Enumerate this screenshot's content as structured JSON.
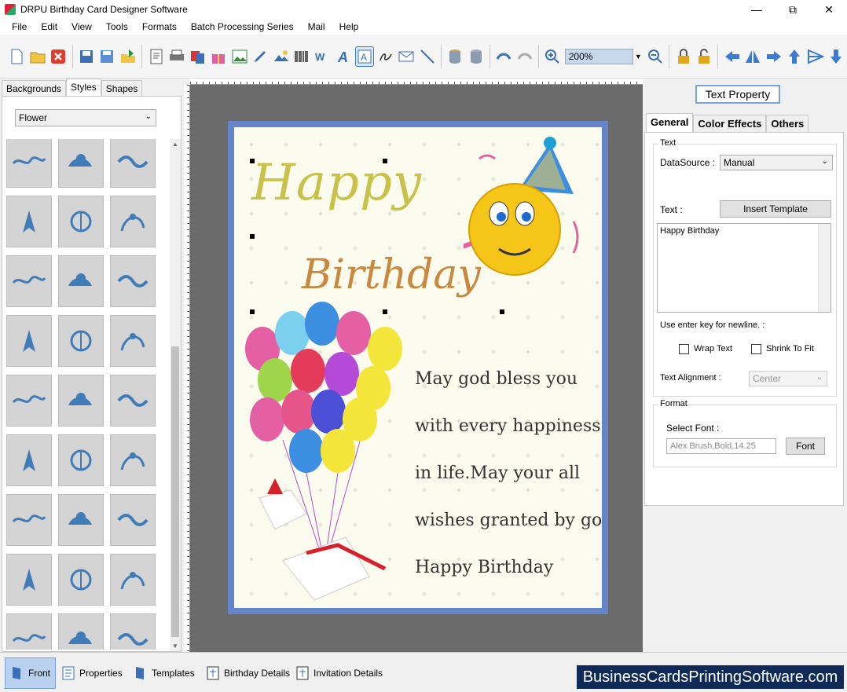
{
  "window": {
    "title": "DRPU Birthday Card Designer Software"
  },
  "menu": [
    "File",
    "Edit",
    "View",
    "Tools",
    "Formats",
    "Batch Processing Series",
    "Mail",
    "Help"
  ],
  "toolbar": {
    "zoom": "200%"
  },
  "left_panel": {
    "tabs": [
      "Backgrounds",
      "Styles",
      "Shapes"
    ],
    "active_tab": "Styles",
    "category": "Flower"
  },
  "card": {
    "happy": "Happy",
    "birthday": "Birthday",
    "lines": [
      "May god bless you",
      "with every happiness",
      "in life.May your all",
      "wishes granted by god.",
      "Happy Birthday"
    ]
  },
  "properties": {
    "title": "Text Property",
    "tabs": [
      "General",
      "Color Effects",
      "Others"
    ],
    "text_group": "Text",
    "datasource_label": "DataSource :",
    "datasource_value": "Manual",
    "text_label": "Text :",
    "insert_template": "Insert Template",
    "text_value": "Happy Birthday",
    "newline_hint": "Use enter key for newline. :",
    "wrap_text": "Wrap Text",
    "shrink_to_fit": "Shrink To Fit",
    "alignment_label": "Text Alignment :",
    "alignment_value": "Center",
    "format_group": "Format",
    "select_font_label": "Select Font :",
    "font_value": "Alex Brush,Bold,14.25",
    "font_button": "Font"
  },
  "bottom_tabs": [
    "Front",
    "Properties",
    "Templates",
    "Birthday Details",
    "Invitation Details"
  ],
  "brand": "BusinessCardsPrintingSoftware.com"
}
